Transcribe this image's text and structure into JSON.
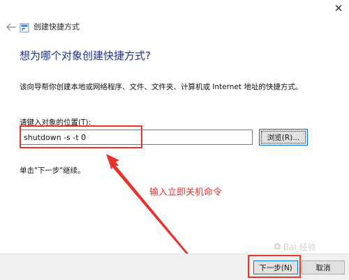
{
  "window": {
    "title": "创建快捷方式",
    "close_glyph": "✕"
  },
  "wizard": {
    "heading": "想为哪个对象创建快捷方式?",
    "description": "该向导帮你创建本地或网络程序、文件、文件夹、计算机或 Internet 地址的快捷方式。",
    "location_label": "请键入对象的位置(T):",
    "location_value": "shutdown -s -t 0",
    "browse_label": "浏览(R)...",
    "hint": "单击\"下一步\"继续。"
  },
  "buttons": {
    "next_label": "下一步(N)",
    "cancel_label": "取消"
  },
  "annotation": {
    "text": "输入立即关机命令",
    "color": "#e8322c"
  },
  "watermark": {
    "text": "Bai 经验"
  },
  "colors": {
    "heading": "#1e3287",
    "accent": "#0078d7",
    "highlight": "#e8322c",
    "footer": "#f0f0f0"
  }
}
